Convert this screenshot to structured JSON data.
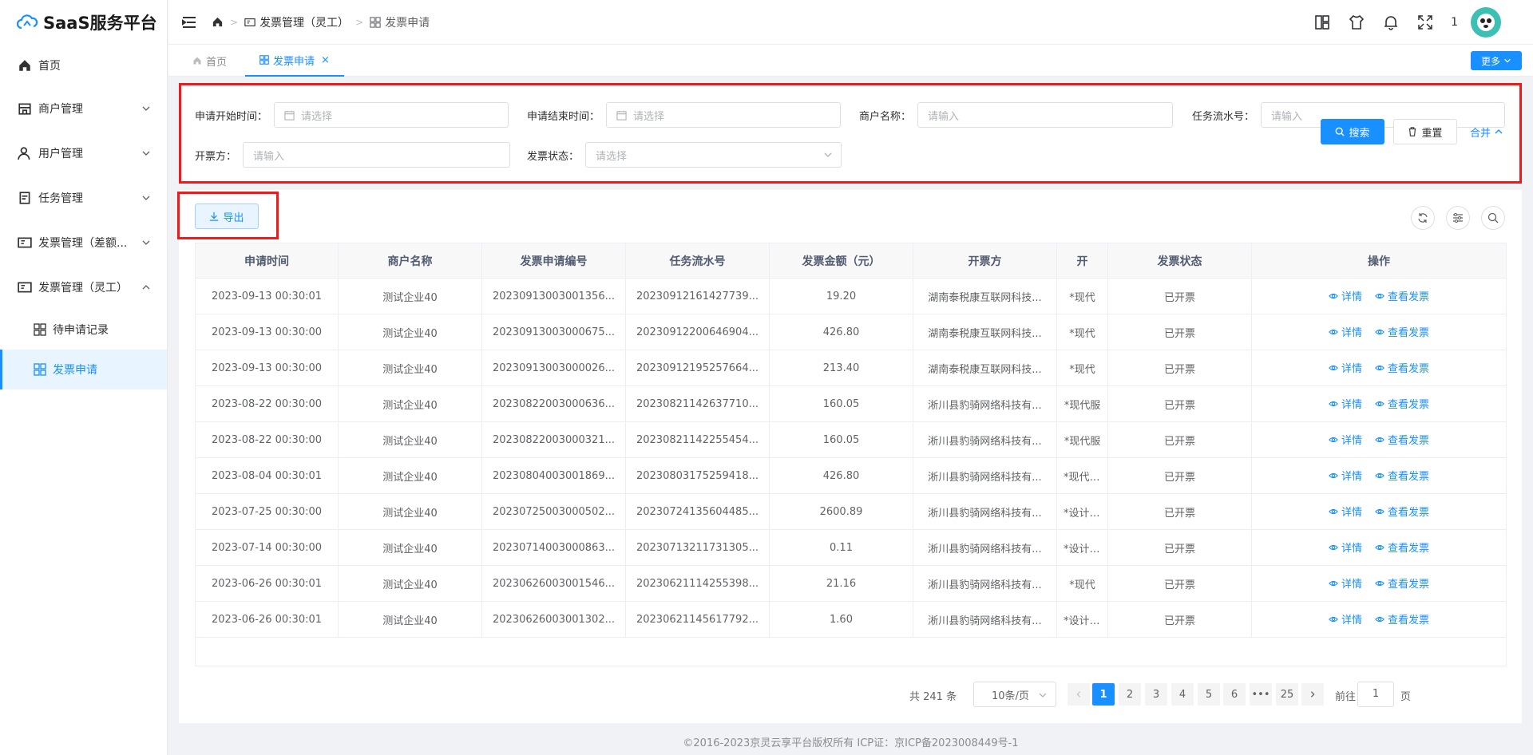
{
  "app": {
    "title": "SaaS服务平台"
  },
  "sidebar": {
    "items": [
      {
        "label": "首页",
        "icon": "home-icon"
      },
      {
        "label": "商户管理",
        "icon": "shop-icon"
      },
      {
        "label": "用户管理",
        "icon": "user-icon"
      },
      {
        "label": "任务管理",
        "icon": "task-icon"
      },
      {
        "label": "发票管理（差额...",
        "icon": "invoice-icon"
      },
      {
        "label": "发票管理（灵工）",
        "icon": "invoice-icon"
      }
    ],
    "subitems": [
      {
        "label": "待申请记录",
        "icon": "grid-icon"
      },
      {
        "label": "发票申请",
        "icon": "grid-icon",
        "active": true
      }
    ]
  },
  "breadcrumb": {
    "level1": "发票管理（灵工）",
    "level2": "发票申请"
  },
  "header": {
    "notify_count": "1"
  },
  "tabs": {
    "home": "首页",
    "current": "发票申请",
    "close": "×",
    "more": "更多"
  },
  "search": {
    "start_label": "申请开始时间：",
    "start_placeholder": "请选择",
    "end_label": "申请结束时间：",
    "end_placeholder": "请选择",
    "merchant_label": "商户名称：",
    "merchant_placeholder": "请输入",
    "task_label": "任务流水号：",
    "task_placeholder": "请输入",
    "issuer_label": "开票方：",
    "issuer_placeholder": "请输入",
    "status_label": "发票状态：",
    "status_placeholder": "请选择",
    "search_btn": "搜索",
    "reset_btn": "重置",
    "collapse_btn": "合并"
  },
  "toolbar": {
    "export_label": "导出"
  },
  "table": {
    "columns": [
      "申请时间",
      "商户名称",
      "发票申请编号",
      "任务流水号",
      "发票金额（元）",
      "开票方",
      "开",
      "发票状态",
      "操作"
    ],
    "op_detail": "详情",
    "op_view": "查看发票",
    "rows": [
      [
        "2023-09-13 00:30:01",
        "测试企业40",
        "20230913003001356...",
        "20230912161427739...",
        "19.20",
        "湖南泰税康互联网科技...",
        "*现代",
        "已开票"
      ],
      [
        "2023-09-13 00:30:00",
        "测试企业40",
        "20230913003000675...",
        "20230912200646904...",
        "426.80",
        "湖南泰税康互联网科技...",
        "*现代",
        "已开票"
      ],
      [
        "2023-09-13 00:30:00",
        "测试企业40",
        "20230913003000026...",
        "20230912195257664...",
        "213.40",
        "湖南泰税康互联网科技...",
        "*现代",
        "已开票"
      ],
      [
        "2023-08-22 00:30:00",
        "测试企业40",
        "20230822003000636...",
        "20230821142637710...",
        "160.05",
        "淅川县豹骑网络科技有...",
        "*现代服",
        "已开票"
      ],
      [
        "2023-08-22 00:30:00",
        "测试企业40",
        "20230822003000321...",
        "20230821142255454...",
        "160.05",
        "淅川县豹骑网络科技有...",
        "*现代服",
        "已开票"
      ],
      [
        "2023-08-04 00:30:01",
        "测试企业40",
        "20230804003001869...",
        "20230803175259418...",
        "426.80",
        "淅川县豹骑网络科技有...",
        "*现代服务",
        "已开票"
      ],
      [
        "2023-07-25 00:30:00",
        "测试企业40",
        "20230725003000502...",
        "20230724135604485...",
        "2600.89",
        "淅川县豹骑网络科技有...",
        "*设计服务",
        "已开票"
      ],
      [
        "2023-07-14 00:30:00",
        "测试企业40",
        "20230714003000863...",
        "20230713211731305...",
        "0.11",
        "淅川县豹骑网络科技有...",
        "*设计服务",
        "已开票"
      ],
      [
        "2023-06-26 00:30:01",
        "测试企业40",
        "20230626003001546...",
        "20230621114255398...",
        "21.16",
        "淅川县豹骑网络科技有...",
        "*现代",
        "已开票"
      ],
      [
        "2023-06-26 00:30:01",
        "测试企业40",
        "20230626003001302...",
        "20230621145617792...",
        "1.60",
        "淅川县豹骑网络科技有...",
        "*设计服务",
        "已开票"
      ]
    ]
  },
  "pagination": {
    "total": "共 241 条",
    "page_size": "10条/页",
    "pages": [
      "1",
      "2",
      "3",
      "4",
      "5",
      "6",
      "•••",
      "25"
    ],
    "current": "1",
    "goto_label": "前往",
    "goto_value": "1",
    "page_suffix": "页"
  },
  "footer": {
    "text": "©2016-2023京灵云享平台版权所有 ICP证：京ICP备2023008449号-1"
  },
  "colors": {
    "accent": "#1890ff",
    "highlight_border": "#f01a1a"
  }
}
